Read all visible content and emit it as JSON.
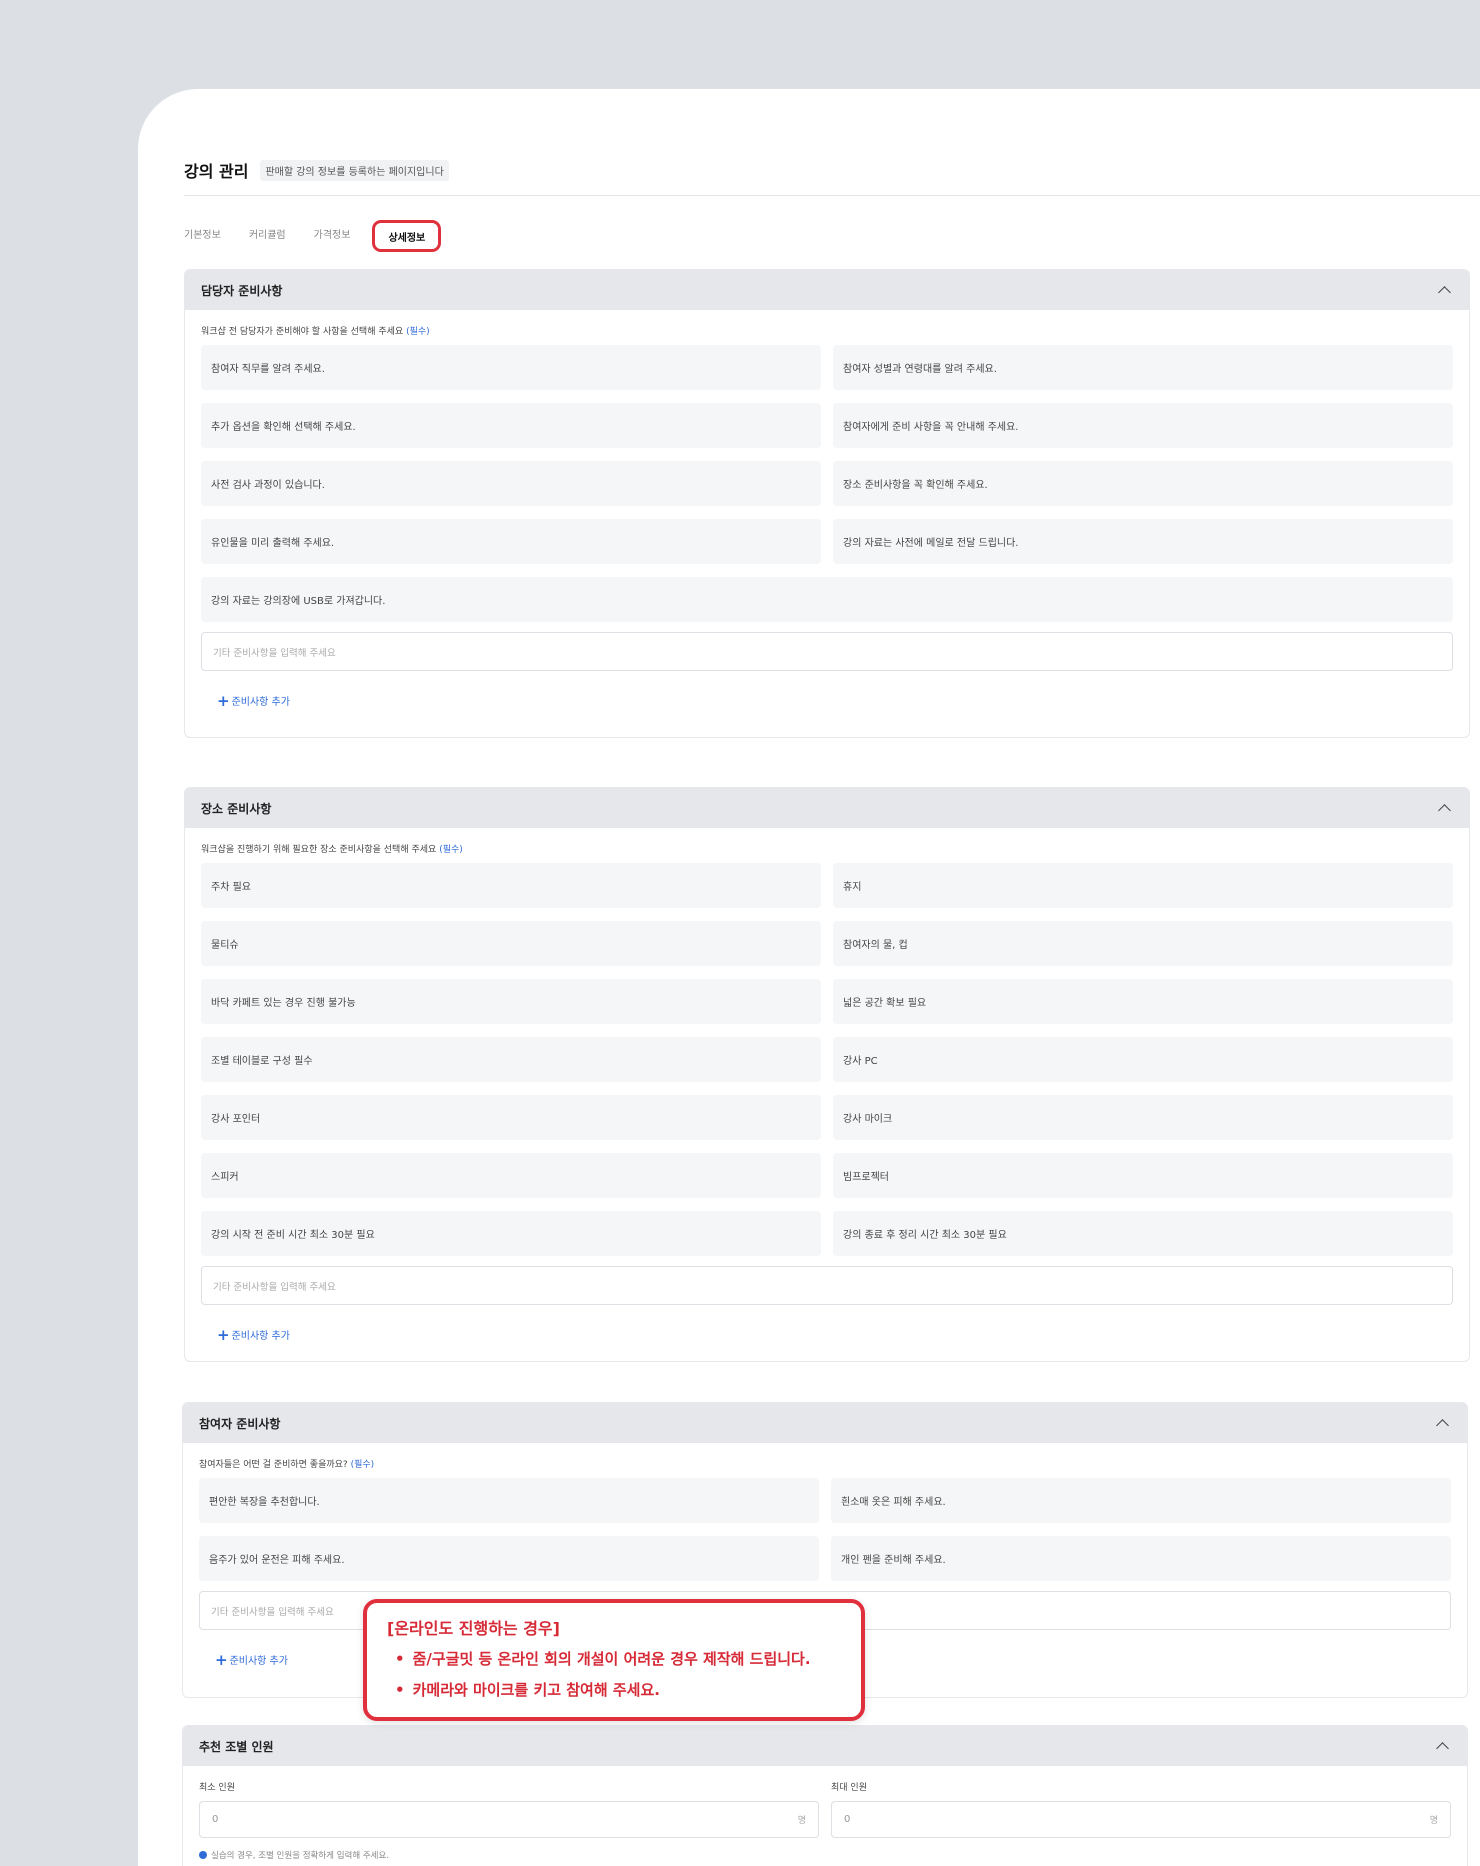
{
  "header": {
    "title": "강의 관리",
    "subtitle": "판매할 강의 정보를 등록하는 페이지입니다"
  },
  "tabs": [
    {
      "label": "기본정보"
    },
    {
      "label": "커리큘럼"
    },
    {
      "label": "가격정보"
    },
    {
      "label": "상세정보"
    }
  ],
  "active_tab": "상세정보",
  "sections": {
    "manager": {
      "title": "담당자 준비사항",
      "desc": "워크샵 전 담당자가 준비해야 할 사항을 선택해 주세요",
      "required": "(필수)",
      "items": [
        "참여자 직무를 알려 주세요.",
        "참여자 성별과 연령대를 알려 주세요.",
        "추가 옵션을 확인해 선택해 주세요.",
        "참여자에게 준비 사항을 꼭 안내해 주세요.",
        "사전 검사 과정이 있습니다.",
        "장소 준비사항을 꼭 확인해 주세요.",
        "유인물을 미리 출력해 주세요.",
        "강의 자료는 사전에 메일로 전달 드립니다.",
        "강의 자료는 강의장에 USB로 가져갑니다."
      ],
      "input_placeholder": "기타 준비사항을 입력해 주세요",
      "add_label": "준비사항 추가"
    },
    "venue": {
      "title": "장소 준비사항",
      "desc": "워크샵을 진행하기 위해 필요한 장소 준비사항을 선택해 주세요",
      "required": "(필수)",
      "items": [
        "주차 필요",
        "휴지",
        "물티슈",
        "참여자의 물, 컵",
        "바닥 카페트 있는 경우 진행 불가능",
        "넓은 공간 확보 필요",
        "조별 테이블로 구성 필수",
        "강사 PC",
        "강사 포인터",
        "강사 마이크",
        "스피커",
        "빔프로젝터",
        "강의 시작 전 준비 시간 최소 30분 필요",
        "강의 종료 후 정리 시간 최소 30분 필요"
      ],
      "input_placeholder": "기타 준비사항을 입력해 주세요",
      "add_label": "준비사항 추가"
    },
    "participant": {
      "title": "참여자 준비사항",
      "desc": "참여자들은 어떤 걸 준비하면 좋을까요?",
      "required": "(필수)",
      "items": [
        "편안한 복장을 추천합니다.",
        "흰소매 옷은 피해 주세요.",
        "음주가 있어 운전은 피해 주세요.",
        "개인 펜을 준비해 주세요."
      ],
      "input_placeholder": "기타 준비사항을 입력해 주세요",
      "add_label": "준비사항 추가"
    },
    "group": {
      "title": "추천 조별 인원",
      "min_label": "최소 인원",
      "max_label": "최대 인원",
      "min_value": "0",
      "max_value": "0",
      "unit": "명",
      "note": "실습의 경우, 조별 인원을 정확하게 입력해 주세요."
    }
  },
  "callout": {
    "title": "[온라인도 진행하는 경우]",
    "lines": [
      "줌/구글밋 등 온라인 회의 개설이 어려운 경우 제작해 드립니다.",
      "카메라와 마이크를 키고 참여해 주세요."
    ]
  },
  "colors": {
    "accent_blue": "#2f6bd8",
    "highlight_red": "#e0303e",
    "section_header_bg": "#e5e7eb"
  }
}
